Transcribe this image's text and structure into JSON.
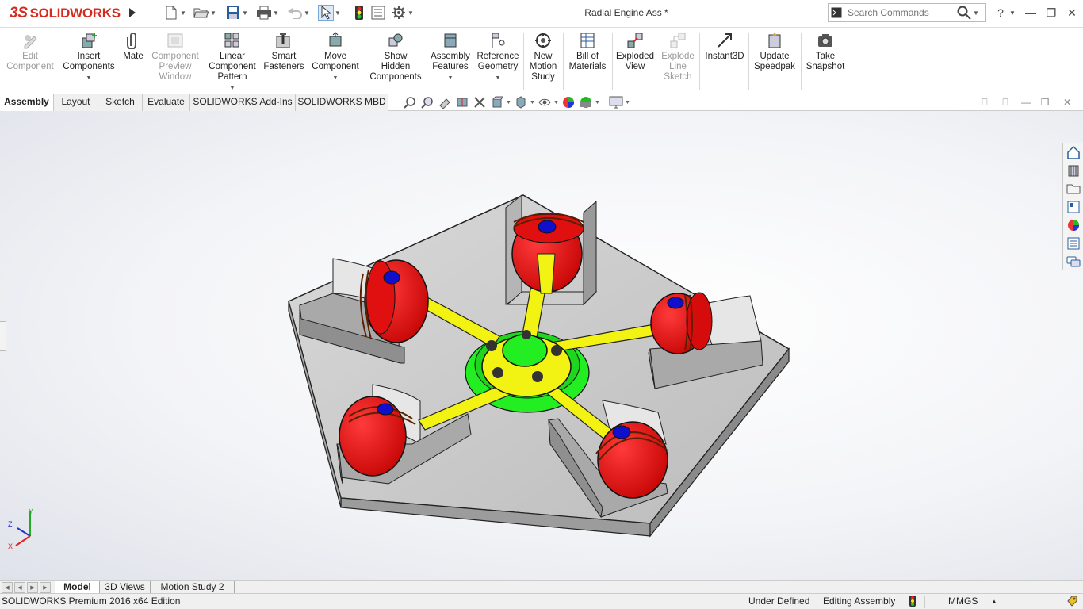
{
  "app": {
    "logo_text": "SOLIDWORKS",
    "logo_mark": "3S",
    "document_title": "Radial Engine Ass *"
  },
  "search": {
    "placeholder": "Search Commands"
  },
  "command_manager": {
    "items": [
      {
        "label": "Edit\nComponent",
        "enabled": false,
        "has_dropdown": false
      },
      {
        "label": "Insert\nComponents",
        "enabled": true,
        "has_dropdown": true
      },
      {
        "label": "Mate",
        "enabled": true,
        "has_dropdown": false
      },
      {
        "label": "Component\nPreview\nWindow",
        "enabled": false,
        "has_dropdown": false
      },
      {
        "label": "Linear\nComponent\nPattern",
        "enabled": true,
        "has_dropdown": true
      },
      {
        "label": "Smart\nFasteners",
        "enabled": true,
        "has_dropdown": false
      },
      {
        "label": "Move\nComponent",
        "enabled": true,
        "has_dropdown": true
      },
      {
        "label": "Show\nHidden\nComponents",
        "enabled": true,
        "has_dropdown": false
      },
      {
        "label": "Assembly\nFeatures",
        "enabled": true,
        "has_dropdown": true
      },
      {
        "label": "Reference\nGeometry",
        "enabled": true,
        "has_dropdown": true
      },
      {
        "label": "New\nMotion\nStudy",
        "enabled": true,
        "has_dropdown": false
      },
      {
        "label": "Bill of\nMaterials",
        "enabled": true,
        "has_dropdown": false
      },
      {
        "label": "Exploded\nView",
        "enabled": true,
        "has_dropdown": false
      },
      {
        "label": "Explode\nLine\nSketch",
        "enabled": false,
        "has_dropdown": false
      },
      {
        "label": "Instant3D",
        "enabled": true,
        "has_dropdown": false
      },
      {
        "label": "Update\nSpeedpak",
        "enabled": true,
        "has_dropdown": false
      },
      {
        "label": "Take\nSnapshot",
        "enabled": true,
        "has_dropdown": false
      }
    ]
  },
  "tabs": [
    "Assembly",
    "Layout",
    "Sketch",
    "Evaluate",
    "SOLIDWORKS Add-Ins",
    "SOLIDWORKS MBD"
  ],
  "active_tab": "Assembly",
  "bottom_tabs": [
    "Model",
    "3D Views",
    "Motion Study 2"
  ],
  "active_bottom_tab": "Model",
  "triad": {
    "x": "X",
    "y": "Y",
    "z": "Z"
  },
  "status": {
    "product": "SOLIDWORKS Premium 2016 x64 Edition",
    "definition": "Under Defined",
    "mode": "Editing Assembly",
    "units": "MMGS",
    "units_arrow": "▲"
  },
  "colors": {
    "piston": "#ee1111",
    "rod": "#f2f213",
    "hub": "#22ee22",
    "plate": "#c8c8c8",
    "pin": "#1010cc",
    "logo": "#d52b1e"
  }
}
